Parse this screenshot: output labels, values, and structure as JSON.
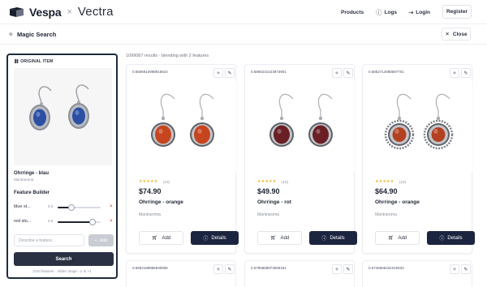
{
  "brand": {
    "name": "Vespa",
    "separator": "×",
    "partner": "Vectra"
  },
  "nav": {
    "products": "Products",
    "logs": "Logs",
    "login": "Login",
    "register": "Register"
  },
  "subheader": {
    "title": "Magic Search",
    "close": "Close"
  },
  "original": {
    "section_label": "ORIGINAL ITEM",
    "name": "Ohrringe - blau",
    "brand": "Mantraroma",
    "feature_builder": {
      "title": "Feature Builder",
      "features": [
        {
          "name": "blue st...",
          "value": "0.3",
          "level": 0.33
        },
        {
          "name": "red sto...",
          "value": "0.5",
          "level": 0.82
        }
      ],
      "input_placeholder": "Describe a feature...",
      "add_label": "Add"
    },
    "search_label": "Search",
    "footer": "2/10 features · Slider range: -1 to +1"
  },
  "results": {
    "info": "1099087 results · blending with 2 features",
    "cards": [
      {
        "id": "0.6506810998916624",
        "rating_count": "(10)",
        "price": "$74.90",
        "name": "Ohrringe - orange",
        "brand": "Mantraroma",
        "add": "Add",
        "details": "Details",
        "stone_color": "#c6451e",
        "frame": "plain"
      },
      {
        "id": "0.6856231423873901",
        "rating_count": "(10)",
        "price": "$49.90",
        "name": "Ohrringe - rot",
        "brand": "Mantraroma",
        "add": "Add",
        "details": "Details",
        "stone_color": "#6a1f24",
        "frame": "plain"
      },
      {
        "id": "0.6852714088697701",
        "rating_count": "(10)",
        "price": "$64.90",
        "name": "Ohrringe - orange",
        "brand": "Mantraroma",
        "add": "Add",
        "details": "Details",
        "stone_color": "#b34020",
        "frame": "ornate"
      }
    ],
    "second_row": [
      {
        "id": "0.6852189896930906"
      },
      {
        "id": "0.6795868873596191"
      },
      {
        "id": "0.6745566431015532"
      }
    ]
  },
  "colors": {
    "accent": "#1c2540",
    "star": "#f0b429",
    "remove": "#c0392b",
    "original_stone": "#2c4fa3"
  },
  "icons": {
    "brand": "logo-mark",
    "logs": "info-circle-icon",
    "login": "login-arrow-icon",
    "magic": "sparkle-icon",
    "close": "close-icon",
    "edit": "edit-icon",
    "cart": "cart-icon",
    "details": "info-circle-icon"
  }
}
